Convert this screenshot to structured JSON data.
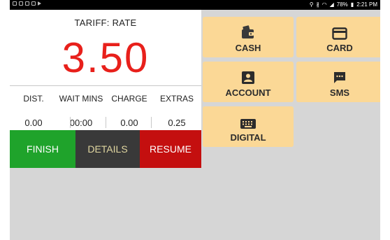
{
  "status_bar": {
    "left_icons": [
      "message-icon",
      "location-icon",
      "gallery-icon",
      "mail-icon",
      "play-icon"
    ],
    "right_icons": [
      "location-icon",
      "bluetooth-icon",
      "wifi-icon",
      "signal-icon"
    ],
    "battery": "78%",
    "time": "2:21 PM"
  },
  "meter": {
    "tariff": "TARIFF: RATE",
    "fare": "3.50",
    "columns": [
      {
        "label": "DIST.",
        "value": "0.00"
      },
      {
        "label": "WAIT MINS",
        "value": "00:00"
      },
      {
        "label": "CHARGE",
        "value": "0.00"
      },
      {
        "label": "EXTRAS",
        "value": "0.25"
      }
    ]
  },
  "actions": {
    "finish": "FINISH",
    "details": "DETAILS",
    "resume": "RESUME"
  },
  "payment": {
    "cash": "CASH",
    "card": "CARD",
    "account": "ACCOUNT",
    "sms": "SMS",
    "digital": "DIGITAL"
  },
  "colors": {
    "fare": "#e8201b",
    "finish": "#1fa32b",
    "details": "#393939",
    "resume": "#c40f0f",
    "payment_tile": "#fbd896",
    "background": "#d6d6d6"
  }
}
